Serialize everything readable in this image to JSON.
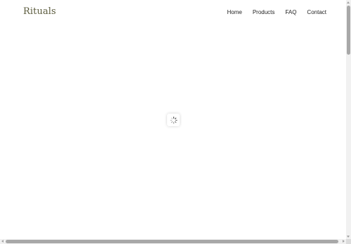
{
  "header": {
    "brand": "Rituals",
    "nav": [
      {
        "label": "Home"
      },
      {
        "label": "Products"
      },
      {
        "label": "FAQ"
      },
      {
        "label": "Contact"
      }
    ]
  },
  "loader": {
    "icon": "spinner-icon",
    "state": "loading"
  },
  "colors": {
    "brand_text": "#5a5a3c",
    "nav_text": "#1f1f1f",
    "background": "#ffffff"
  },
  "scrollbars": {
    "vertical": true,
    "horizontal": true
  }
}
